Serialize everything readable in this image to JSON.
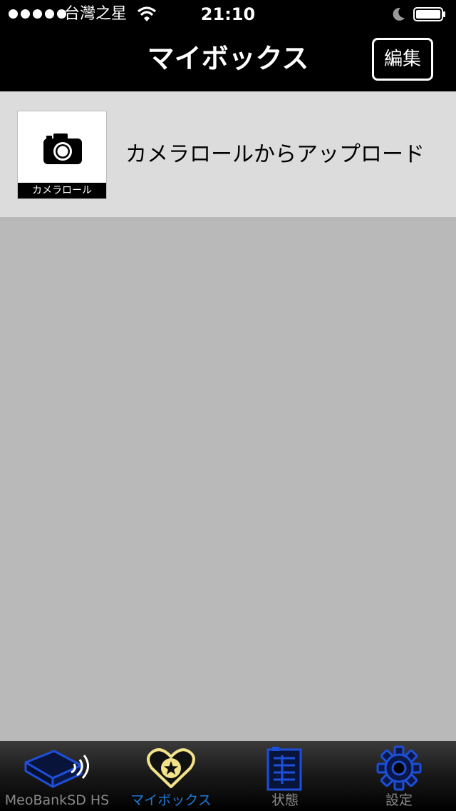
{
  "status_bar": {
    "carrier": "台灣之星",
    "time": "21:10"
  },
  "nav": {
    "title": "マイボックス",
    "edit_label": "編集"
  },
  "list": [
    {
      "thumb_label": "カメラロール",
      "label": "カメラロールからアップロード"
    }
  ],
  "tabs": [
    {
      "label": "MeoBankSD HS",
      "icon": "device-wifi-icon",
      "active": false
    },
    {
      "label": "マイボックス",
      "icon": "heart-star-icon",
      "active": true
    },
    {
      "label": "状態",
      "icon": "status-document-icon",
      "active": false
    },
    {
      "label": "設定",
      "icon": "gear-icon",
      "active": false
    }
  ],
  "colors": {
    "accent": "#1e7ad8",
    "heart": "#f2e28a",
    "tab_icon_blue": "#1e4fd8",
    "background": "#b9b9b9",
    "row_background": "#dcdcdc"
  }
}
